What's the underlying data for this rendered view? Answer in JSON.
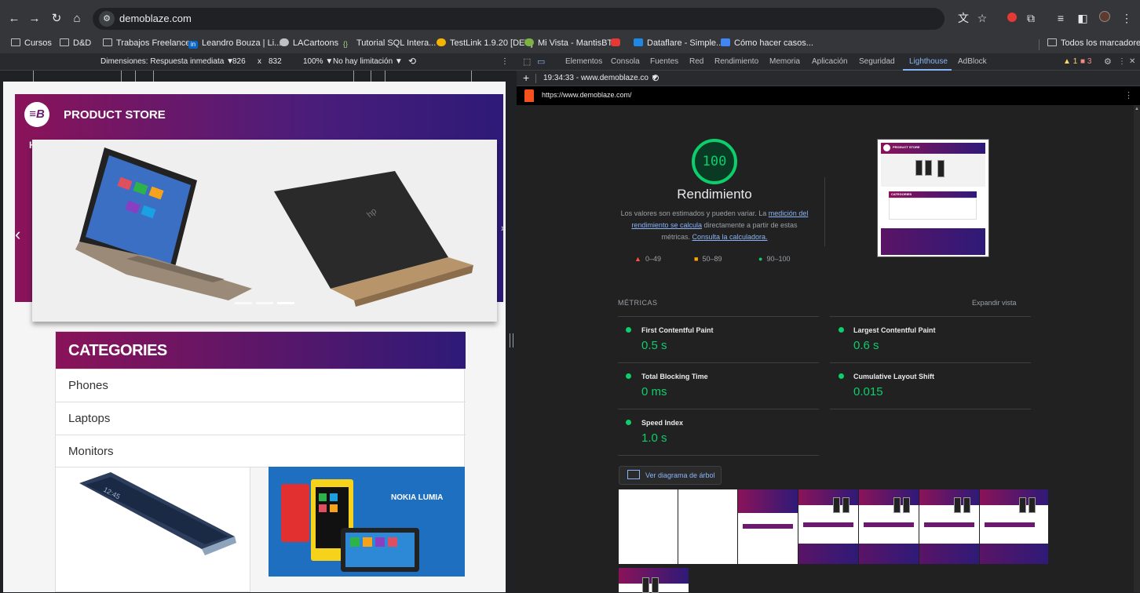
{
  "browser": {
    "url": "demoblaze.com",
    "bookmarks": [
      {
        "label": "Cursos",
        "icon": "folder-icon"
      },
      {
        "label": "D&D",
        "icon": "folder-icon"
      },
      {
        "label": "Trabajos Freelance",
        "icon": "folder-icon"
      },
      {
        "label": "Leandro Bouza | Li...",
        "icon": "linkedin-icon"
      },
      {
        "label": "LACartoons",
        "icon": "globe-icon"
      },
      {
        "label": "Tutorial SQL Intera...",
        "icon": "sql-icon"
      },
      {
        "label": "TestLink 1.9.20 [DEV]",
        "icon": "testlink-icon"
      },
      {
        "label": "Mi Vista - MantisBT",
        "icon": "mantis-icon"
      },
      {
        "label": "",
        "icon": "youtube-icon"
      },
      {
        "label": "Dataflare - Simple...",
        "icon": "dataflare-icon"
      },
      {
        "label": "Cómo hacer casos...",
        "icon": "doc-icon"
      }
    ],
    "all_bookmarks": "Todos los marcadores"
  },
  "device_toolbar": {
    "dimensions": "Dimensiones: Respuesta inmediata ▼",
    "width": "826",
    "x": "x",
    "height": "832",
    "zoom": "100% ▼",
    "throttle": "No hay limitación ▼"
  },
  "site": {
    "brand": "PRODUCT STORE",
    "logo_letter": "≡B",
    "hero_letter": "H",
    "categories_title": "CATEGORIES",
    "categories": [
      "Phones",
      "Laptops",
      "Monitors"
    ],
    "nokia_label": "NOKIA LUMIA"
  },
  "devtools": {
    "tabs": [
      "Elementos",
      "Consola",
      "Fuentes",
      "Red",
      "Rendimiento",
      "Memoria",
      "Aplicación",
      "Seguridad",
      "Lighthouse",
      "AdBlock"
    ],
    "active_tab": "Lighthouse",
    "warnings": "1",
    "errors": "3",
    "report_select": "19:34:33 - www.demoblaze.co ▼",
    "report_url": "https://www.demoblaze.com/"
  },
  "lighthouse": {
    "score": "100",
    "category": "Rendimiento",
    "desc_1": "Los valores son estimados y pueden variar. La",
    "desc_link_1": "medición del",
    "desc_link_2": "rendimiento se calcula",
    "desc_2": "directamente a partir de estas",
    "desc_3": "métricas.",
    "desc_link_3": "Consulta la calculadora.",
    "legend": [
      {
        "range": "0–49",
        "color": "#ff4e42"
      },
      {
        "range": "50–89",
        "color": "#ffa400"
      },
      {
        "range": "90–100",
        "color": "#0cce6b"
      }
    ],
    "metrics_title": "MÉTRICAS",
    "expand": "Expandir vista",
    "metrics": [
      {
        "name": "First Contentful Paint",
        "value": "0.5 s"
      },
      {
        "name": "Largest Contentful Paint",
        "value": "0.6 s"
      },
      {
        "name": "Total Blocking Time",
        "value": "0 ms"
      },
      {
        "name": "Cumulative Layout Shift",
        "value": "0.015"
      },
      {
        "name": "Speed Index",
        "value": "1.0 s"
      }
    ],
    "treemap_button": "Ver diagrama de árbol",
    "thumb_brand": "PRODUCT STORE",
    "thumb_categories": "CATEGORIES"
  }
}
